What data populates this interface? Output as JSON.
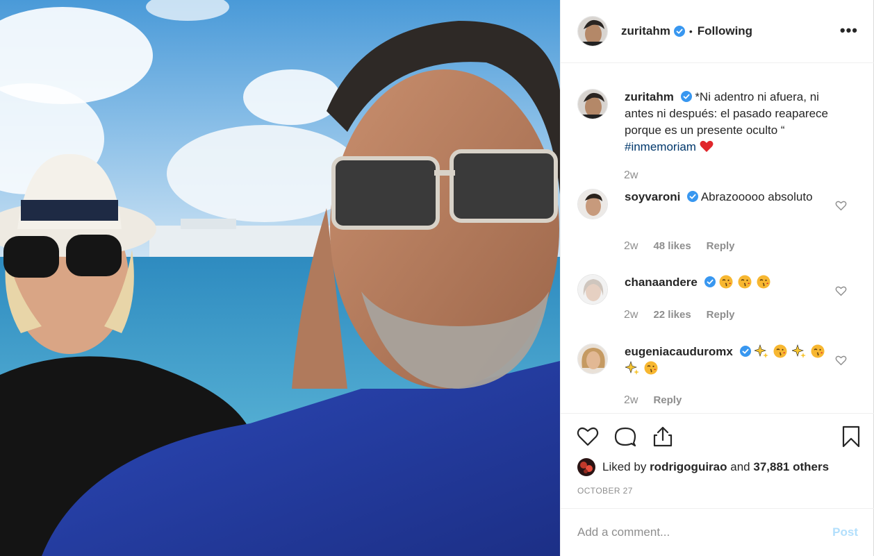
{
  "post": {
    "author": "zuritahm",
    "follow_dot": "•",
    "follow_status": "Following",
    "more_label": "•••"
  },
  "caption": {
    "username": "zuritahm",
    "text": "*Ni adentro ni afuera, ni antes ni después: el pasado reaparece porque es un presente oculto “",
    "hashtag": "#inmemoriam",
    "time": "2w"
  },
  "comments": [
    {
      "username": "soyvaroni",
      "text": "Abrazooooo absoluto",
      "time": "2w",
      "likes": "48 likes",
      "reply": "Reply",
      "emojis": []
    },
    {
      "username": "chanaandere",
      "text": "",
      "time": "2w",
      "likes": "22 likes",
      "reply": "Reply",
      "emojis": [
        "kiss-face",
        "kiss-face",
        "kiss-face"
      ]
    },
    {
      "username": "eugeniacauduromx",
      "text": "",
      "time": "2w",
      "likes": "",
      "reply": "Reply",
      "emojis": [
        "sparkles",
        "kiss-face",
        "sparkles",
        "kiss-face",
        "sparkles",
        "kiss-face"
      ]
    }
  ],
  "actions": {
    "liked_by_prefix": "Liked by",
    "liked_by_user": "rodrigoguirao",
    "liked_by_and": "and",
    "liked_by_others": "37,881 others",
    "date": "OCTOBER 27"
  },
  "add_comment": {
    "placeholder": "Add a comment...",
    "post_label": "Post"
  },
  "colors": {
    "verified": "#3897f0",
    "link": "#00376b",
    "muted": "#8e8e8e",
    "post_disabled": "#b2dffc",
    "heart": "#ed4956"
  }
}
